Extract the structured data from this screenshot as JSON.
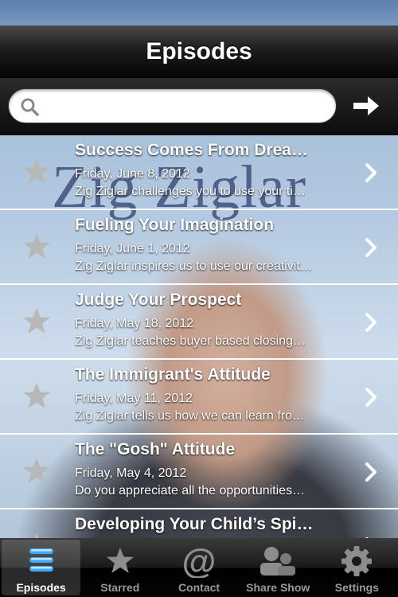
{
  "header": {
    "title": "Episodes"
  },
  "search": {
    "placeholder": "",
    "value": ""
  },
  "background": {
    "brand_text": "Zig Ziglar"
  },
  "episodes": [
    {
      "title": "Success Comes From Drea…",
      "date": "Friday, June 8, 2012",
      "description": "Zig Ziglar challenges you to use your ti…"
    },
    {
      "title": "Fueling Your Imagination",
      "date": "Friday, June 1, 2012",
      "description": "Zig Ziglar inspires us to use our creativit…"
    },
    {
      "title": "Judge Your Prospect",
      "date": "Friday, May 18, 2012",
      "description": "Zig Ziglar teaches buyer based closing…"
    },
    {
      "title": "The Immigrant's Attitude",
      "date": "Friday, May 11, 2012",
      "description": "Zig Ziglar tells us how we can learn fro…"
    },
    {
      "title": "The \"Gosh\" Attitude",
      "date": "Friday, May 4, 2012",
      "description": "Do you appreciate all the opportunities…"
    },
    {
      "title": "Developing Your Child’s Spi…",
      "date": "",
      "description": ""
    }
  ],
  "tabs": [
    {
      "label": "Episodes",
      "icon": "list-icon",
      "active": true
    },
    {
      "label": "Starred",
      "icon": "star-icon",
      "active": false
    },
    {
      "label": "Contact",
      "icon": "at-icon",
      "active": false
    },
    {
      "label": "Share Show",
      "icon": "people-icon",
      "active": false
    },
    {
      "label": "Settings",
      "icon": "gear-icon",
      "active": false
    }
  ],
  "colors": {
    "accent": "#3fa9f5",
    "star": "#b8b8b8",
    "row_divider": "#ffffff"
  }
}
